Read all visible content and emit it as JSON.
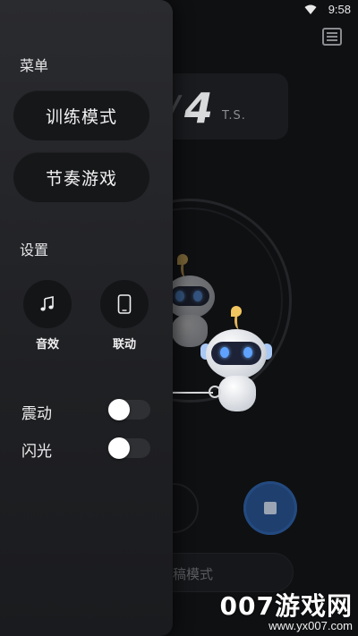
{
  "status_bar": {
    "time": "9:58",
    "wifi_icon": "wifi-icon"
  },
  "background": {
    "bpm_value": "4",
    "bpm_unit": "T.S.",
    "mode_label": "稿模式",
    "list_icon": "list-icon",
    "stop_icon": "stop-icon"
  },
  "drawer": {
    "menu_title": "菜单",
    "menu_items": [
      {
        "label": "训练模式"
      },
      {
        "label": "节奏游戏"
      }
    ],
    "settings_title": "设置",
    "settings_buttons": [
      {
        "label": "音效",
        "icon": "music-note-icon"
      },
      {
        "label": "联动",
        "icon": "phone-icon"
      }
    ],
    "toggles": [
      {
        "label": "震动",
        "on": false
      },
      {
        "label": "闪光",
        "on": false
      }
    ]
  },
  "watermark": {
    "brand": "007游戏网",
    "url": "www.yx007.com"
  },
  "colors": {
    "drawer_bg": "#252629",
    "button_bg": "#161719",
    "accent_stop": "#1f3f6e",
    "knob": "#ffffff"
  }
}
